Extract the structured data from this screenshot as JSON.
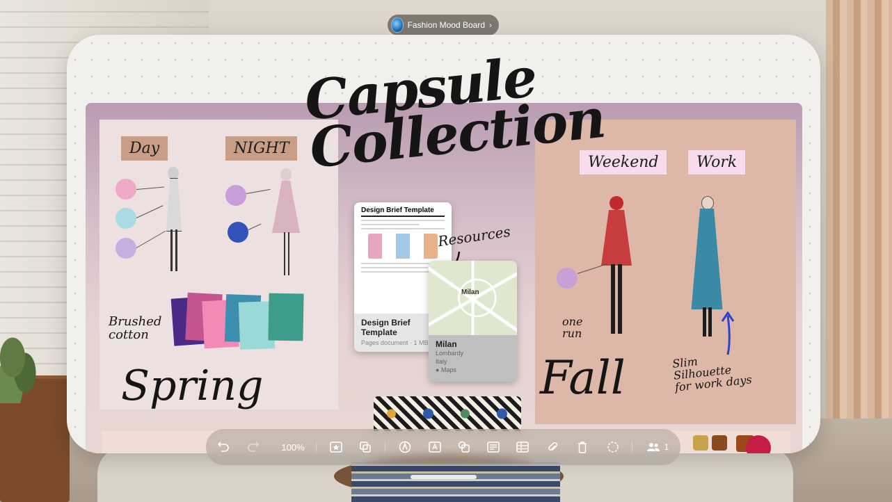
{
  "window": {
    "title": "Fashion Mood Board"
  },
  "board": {
    "heading": "Capsule\nCollection",
    "labels": {
      "day": "Day",
      "night": "NIGHT",
      "weekend": "Weekend",
      "work": "Work",
      "spring": "Spring",
      "fall": "Fall",
      "resources": "Resources",
      "brushed_cotton": "Brushed\ncotton",
      "slim_silhouette": "Slim\nSilhouette\nfor work days",
      "note_fall": "one\nrun"
    },
    "doc_card": {
      "title": "Design Brief Template",
      "name": "Design Brief\nTemplate",
      "meta": "Pages document · 1 MB"
    },
    "map_card": {
      "map_label": "Milan",
      "name": "Milan",
      "region": "Lombardy",
      "country": "Italy",
      "source": "Maps"
    }
  },
  "toolbar": {
    "zoom": "100%",
    "participants": "1",
    "icons": [
      "undo-icon",
      "redo-icon",
      "insert-media-icon",
      "copy-icon",
      "pen-icon",
      "text-box-icon",
      "shapes-icon",
      "sticky-note-icon",
      "table-icon",
      "attachment-icon",
      "delete-icon",
      "lasso-icon",
      "people-icon"
    ]
  },
  "colors": {
    "accent_pink": "#e39ab9",
    "accent_blue": "#3c63b0",
    "tag_tan": "#c89f86",
    "tag_pink": "#f6dcec"
  }
}
